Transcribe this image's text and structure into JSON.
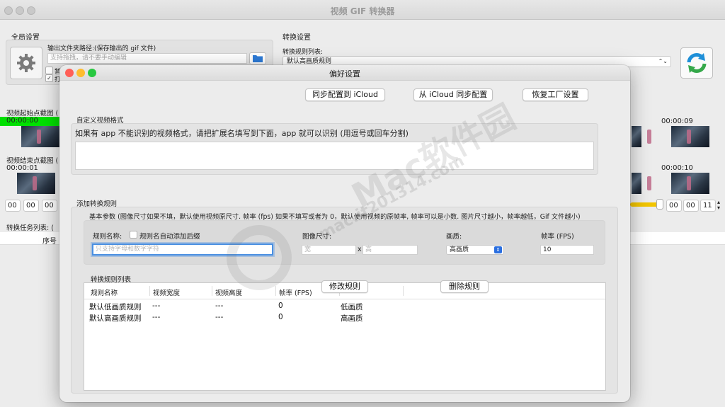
{
  "app": {
    "title": "视频 GIF 转换器"
  },
  "global": {
    "section_label": "全局设置",
    "output_label": "输出文件夹路径:(保存输出的 gif 文件)",
    "output_placeholder": "支持拖拽，请不要手动编辑",
    "check1_label": "暂",
    "check2_label": "打"
  },
  "convert": {
    "section_label": "转换设置",
    "rule_list_label": "转换规则列表:",
    "selected_rule": "默认高画质规则"
  },
  "timeline": {
    "start_label": "视频起始点截图 (",
    "start_time": "00:00:00",
    "end_label": "视频结束点截图 (",
    "end_time": "00:00:01",
    "right_time_1": "00:00:09",
    "right_time_2": "00:00:10",
    "left_spin": [
      "00",
      "00",
      "00"
    ],
    "right_spin": [
      "00",
      "00",
      "11"
    ],
    "task_label": "转换任务列表: (",
    "col_index": "序号"
  },
  "prefs": {
    "title": "偏好设置",
    "btn_sync_to": "同步配置到 iCloud",
    "btn_sync_from": "从 iCloud 同步配置",
    "btn_reset": "恢复工厂设置",
    "custom_format_label": "自定义视频格式",
    "custom_format_hint": "如果有 app 不能识别的视频格式，请把扩展名填写到下面，app 就可以识别 (用逗号或回车分割)",
    "add_rule_label": "添加转换规则",
    "basic_params": "基本参数 (图像尺寸如果不填，默认使用视频原尺寸. 帧率 (fps) 如果不填写或者为 0，默认使用视频的原帧率, 帧率可以是小数. 图片尺寸越小，帧率越低，Gif 文件越小)",
    "rule_name_label": "规则名称:",
    "auto_suffix_label": "规则名自动添加后缀",
    "rule_name_placeholder": "只支持字母和数字字符",
    "size_label": "图像尺寸:",
    "width_placeholder": "宽",
    "height_placeholder": "高",
    "size_x": "x",
    "quality_label": "画质:",
    "quality_value": "高画质",
    "fps_label": "帧率 (FPS)",
    "fps_value": "10",
    "rules_list_label": "转换规则列表",
    "btn_modify": "修改规则",
    "btn_delete": "删除规则",
    "columns": [
      "规则名称",
      "视频宽度",
      "视频高度",
      "帧率 (FPS)"
    ],
    "rows": [
      {
        "name": "默认低画质规则",
        "width": "---",
        "height": "---",
        "fps": "0",
        "quality": "低画质"
      },
      {
        "name": "默认高画质规则",
        "width": "---",
        "height": "---",
        "fps": "0",
        "quality": "高画质"
      }
    ]
  },
  "watermark": {
    "text1": "Mac软件园",
    "text2": "mac.it201314.com"
  },
  "colors": {
    "accent": "#4a90e2",
    "slider": "#f2c500",
    "start_bar": "#00e000",
    "close": "#ff5f57",
    "minimize": "#febc2e",
    "zoom": "#28c840"
  }
}
